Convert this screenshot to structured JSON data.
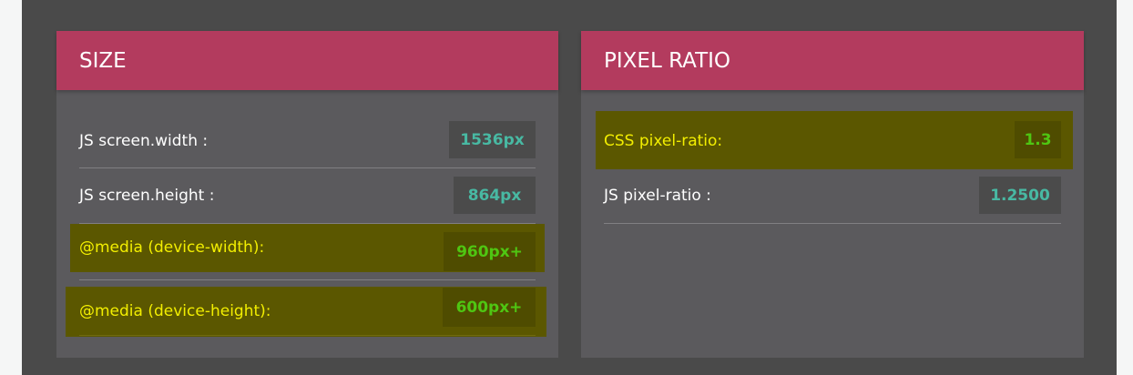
{
  "size": {
    "title": "SIZE",
    "rows": [
      {
        "label": "JS screen.width :",
        "value": "1536px"
      },
      {
        "label": "JS screen.height :",
        "value": "864px"
      },
      {
        "label": "@media (device-width):",
        "value": "960px+"
      },
      {
        "label": "@media (device-height):",
        "value": "600px+"
      }
    ]
  },
  "pixel_ratio": {
    "title": "PIXEL RATIO",
    "rows": [
      {
        "label": "CSS pixel-ratio:",
        "value": "1.3"
      },
      {
        "label": "JS pixel-ratio :",
        "value": "1.2500"
      }
    ]
  },
  "colors": {
    "header": "#b33b5e",
    "highlight": "#5b5700",
    "value_text": "#48b9a3",
    "highlight_value_text": "#4fc612",
    "highlight_label_text": "#f2ee00"
  }
}
